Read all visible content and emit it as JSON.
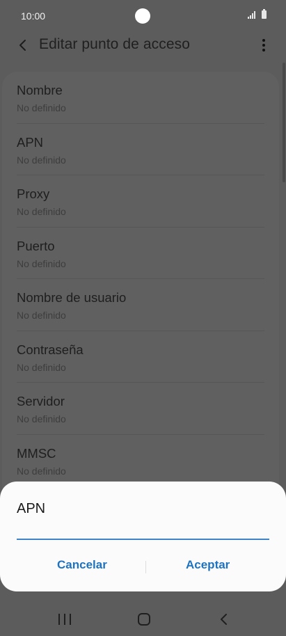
{
  "status_bar": {
    "time": "10:00"
  },
  "header": {
    "title": "Editar punto de acceso"
  },
  "list": [
    {
      "label": "Nombre",
      "value": "No definido"
    },
    {
      "label": "APN",
      "value": "No definido"
    },
    {
      "label": "Proxy",
      "value": "No definido"
    },
    {
      "label": "Puerto",
      "value": "No definido"
    },
    {
      "label": "Nombre de usuario",
      "value": "No definido"
    },
    {
      "label": "Contraseña",
      "value": "No definido"
    },
    {
      "label": "Servidor",
      "value": "No definido"
    },
    {
      "label": "MMSC",
      "value": "No definido"
    }
  ],
  "dialog": {
    "title": "APN",
    "input_value": "",
    "cancel_label": "Cancelar",
    "accept_label": "Aceptar"
  },
  "colors": {
    "accent": "#1e73c0",
    "input_underline": "#3e82c7",
    "dim_background": "#5c5c5c",
    "dialog_background": "#fbfbfb"
  },
  "icons": {
    "back": "chevron-left-icon",
    "more": "more-vertical-icon",
    "signal": "signal-icon",
    "battery": "battery-icon",
    "nav_recent": "recent-apps-icon",
    "nav_home": "home-icon",
    "nav_back": "back-icon"
  }
}
